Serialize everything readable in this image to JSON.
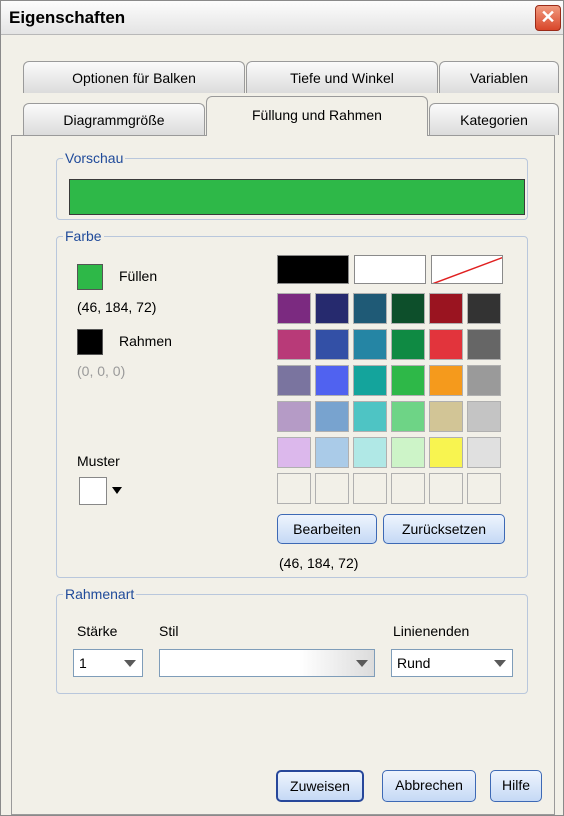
{
  "window": {
    "title": "Eigenschaften",
    "close_symbol": "✕"
  },
  "tabs": {
    "row1": [
      "Optionen für Balken",
      "Tiefe und Winkel",
      "Variablen"
    ],
    "row2": [
      "Diagrammgröße",
      "Füllung und Rahmen",
      "Kategorien"
    ],
    "active": "Füllung und Rahmen"
  },
  "preview": {
    "legend": "Vorschau",
    "color": "#2eb848"
  },
  "color_group": {
    "legend": "Farbe",
    "fill": {
      "label": "Füllen",
      "value": "(46, 184, 72)",
      "color": "#2eb848"
    },
    "border": {
      "label": "Rahmen",
      "value": "(0, 0, 0)",
      "color": "#000000"
    },
    "pattern_label": "Muster",
    "selected_value": "(46, 184, 72)",
    "edit_button": "Bearbeiten",
    "reset_button": "Zurücksetzen",
    "top_row_colors": [
      "#000000",
      "#ffffff",
      "none"
    ],
    "palette": [
      [
        "#7b2a80",
        "#262a6e",
        "#1f5a76",
        "#0d4f2b",
        "#9a1420",
        "#333333"
      ],
      [
        "#b83a78",
        "#3350a6",
        "#2585a4",
        "#0f8a43",
        "#e2343c",
        "#666666"
      ],
      [
        "#7a749f",
        "#5062f0",
        "#14a49c",
        "#2eb848",
        "#f59a1c",
        "#9a9a9a"
      ],
      [
        "#b59bc6",
        "#78a3cf",
        "#4ec4c4",
        "#6ed486",
        "#d2c596",
        "#c4c4c4"
      ],
      [
        "#dcb8ec",
        "#aacbe8",
        "#b0e8e6",
        "#cdf4c8",
        "#f8f450",
        "#e0e0e0"
      ],
      [
        "#f2f0e8",
        "#f2f0e8",
        "#f2f0e8",
        "#f2f0e8",
        "#f2f0e8",
        "#f2f0e8"
      ]
    ]
  },
  "border_style": {
    "legend": "Rahmenart",
    "weight": {
      "label": "Stärke",
      "value": "1"
    },
    "style": {
      "label": "Stil",
      "value": ""
    },
    "line_ends": {
      "label": "Linienenden",
      "value": "Rund"
    }
  },
  "buttons": {
    "apply": "Zuweisen",
    "cancel": "Abbrechen",
    "help": "Hilfe"
  }
}
